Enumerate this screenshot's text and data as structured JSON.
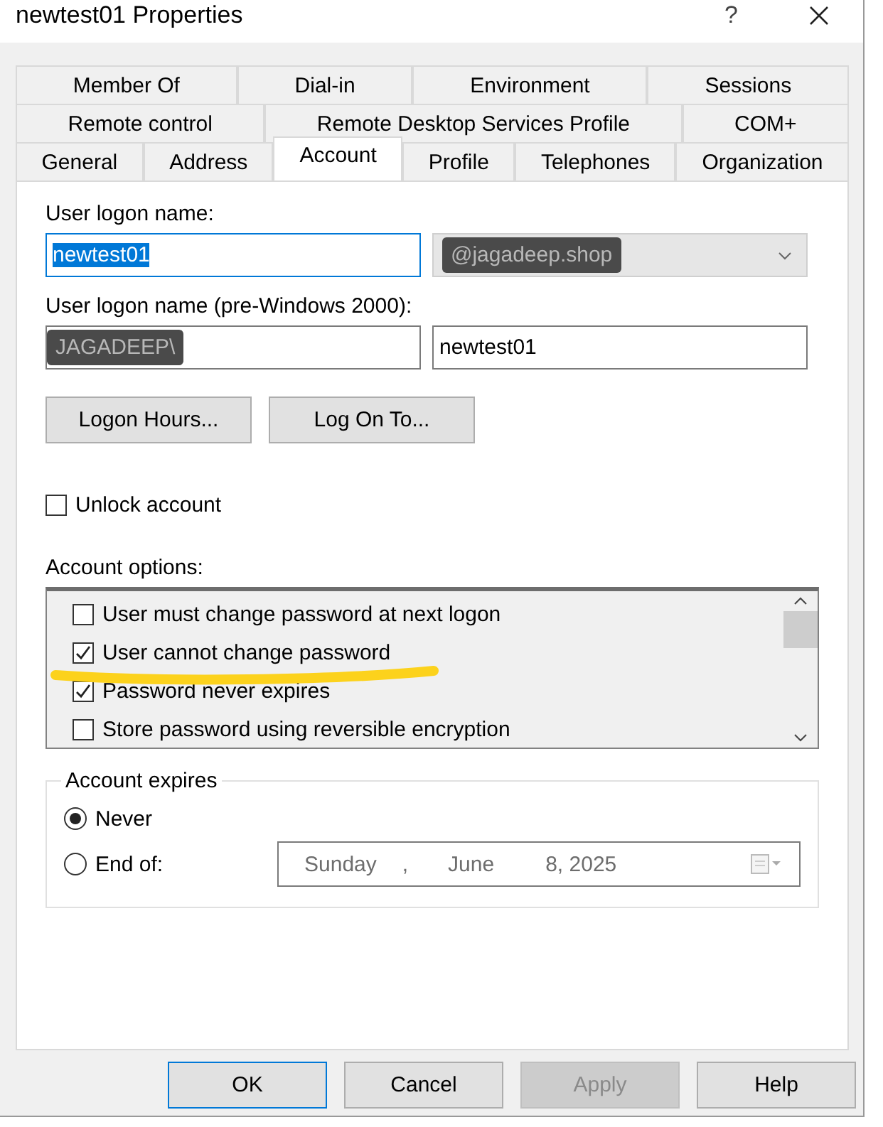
{
  "window": {
    "title": "newtest01 Properties",
    "help_glyph": "?"
  },
  "tab_rows": [
    {
      "tabs": [
        {
          "label": "Member Of",
          "selected": false
        },
        {
          "label": "Dial-in",
          "selected": false
        },
        {
          "label": "Environment",
          "selected": false
        },
        {
          "label": "Sessions",
          "selected": false
        }
      ]
    },
    {
      "tabs": [
        {
          "label": "Remote control",
          "selected": false
        },
        {
          "label": "Remote Desktop Services Profile",
          "selected": false
        },
        {
          "label": "COM+",
          "selected": false
        }
      ]
    },
    {
      "tabs": [
        {
          "label": "General",
          "selected": false
        },
        {
          "label": "Address",
          "selected": false
        },
        {
          "label": "Account",
          "selected": true
        },
        {
          "label": "Profile",
          "selected": false
        },
        {
          "label": "Telephones",
          "selected": false
        },
        {
          "label": "Organization",
          "selected": false
        }
      ]
    }
  ],
  "logon_name": {
    "label": "User logon name:",
    "value": "newtest01",
    "text_selected": true,
    "domain": {
      "value": "@jagadeep.shop",
      "disabled": true,
      "redacted": true
    }
  },
  "pre2000_name": {
    "label": "User logon name (pre-Windows 2000):",
    "domain": {
      "value": "JAGADEEP\\",
      "redacted": true
    },
    "value": "newtest01"
  },
  "logon_buttons": [
    "Logon Hours...",
    "Log On To..."
  ],
  "unlock": {
    "label": "Unlock account",
    "checked": false
  },
  "account_options": {
    "label": "Account options:",
    "items": [
      {
        "label": "User must change password at next logon",
        "checked": false,
        "highlighted": false
      },
      {
        "label": "User cannot change password",
        "checked": true,
        "highlighted": true
      },
      {
        "label": "Password never expires",
        "checked": true,
        "highlighted": false
      },
      {
        "label": "Store password using reversible encryption",
        "checked": false,
        "highlighted": false
      }
    ]
  },
  "account_expires": {
    "legend": "Account expires",
    "options": [
      {
        "label": "Never",
        "selected": true
      },
      {
        "label": "End of:",
        "selected": false
      }
    ],
    "date": {
      "weekday": "Sunday",
      "separator": ",",
      "month": "June",
      "day_year": "8, 2025",
      "disabled": true
    }
  },
  "dialog_buttons": [
    {
      "label": "OK",
      "default": true,
      "disabled": false
    },
    {
      "label": "Cancel",
      "default": false,
      "disabled": false
    },
    {
      "label": "Apply",
      "default": false,
      "disabled": true
    },
    {
      "label": "Help",
      "default": false,
      "disabled": false
    }
  ]
}
